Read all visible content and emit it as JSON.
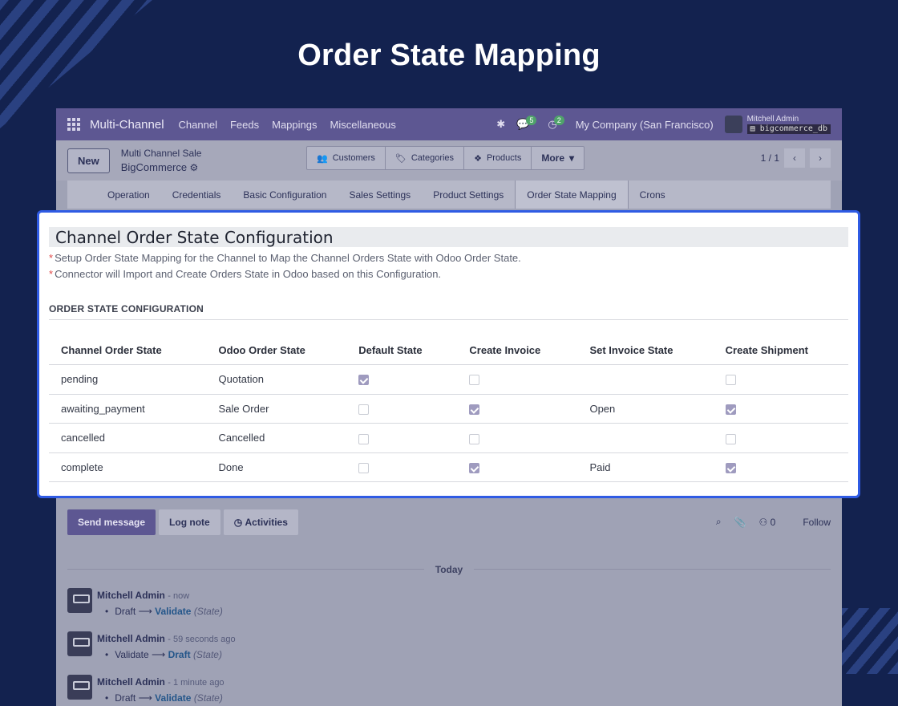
{
  "page_title": "Order State Mapping",
  "navbar": {
    "app_name": "Multi-Channel",
    "menus": [
      "Channel",
      "Feeds",
      "Mappings",
      "Miscellaneous"
    ],
    "messages_badge": "5",
    "activities_badge": "2",
    "company": "My Company (San Francisco)",
    "user_name": "Mitchell Admin",
    "database": "bigcommerce_db"
  },
  "control_panel": {
    "new_label": "New",
    "breadcrumb_parent": "Multi Channel Sale",
    "breadcrumb_record": "BigCommerce",
    "smart_buttons": [
      "Customers",
      "Categories",
      "Products",
      "More"
    ],
    "pager": "1 / 1"
  },
  "tabs": [
    "Operation",
    "Credentials",
    "Basic Configuration",
    "Sales Settings",
    "Product Settings",
    "Order State Mapping",
    "Crons"
  ],
  "card": {
    "title": "Channel Order State Configuration",
    "notes": [
      "Setup Order State Mapping for the Channel to Map the Channel Orders State with Odoo Order State.",
      "Connector will Import and Create Orders State in Odoo based on this Configuration."
    ],
    "section_label": "ORDER STATE CONFIGURATION",
    "columns": [
      "Channel Order State",
      "Odoo Order State",
      "Default State",
      "Create Invoice",
      "Set Invoice State",
      "Create Shipment"
    ],
    "rows": [
      {
        "channel_state": "pending",
        "odoo_state": "Quotation",
        "default_state": true,
        "create_invoice": false,
        "invoice_state": "",
        "create_shipment": false
      },
      {
        "channel_state": "awaiting_payment",
        "odoo_state": "Sale Order",
        "default_state": false,
        "create_invoice": true,
        "invoice_state": "Open",
        "create_shipment": true
      },
      {
        "channel_state": "cancelled",
        "odoo_state": "Cancelled",
        "default_state": false,
        "create_invoice": false,
        "invoice_state": "",
        "create_shipment": false
      },
      {
        "channel_state": "complete",
        "odoo_state": "Done",
        "default_state": false,
        "create_invoice": true,
        "invoice_state": "Paid",
        "create_shipment": true
      }
    ]
  },
  "chatter": {
    "send_message": "Send message",
    "log_note": "Log note",
    "activities": "Activities",
    "followers_count": "0",
    "follow": "Follow",
    "today": "Today",
    "messages": [
      {
        "author": "Mitchell Admin",
        "time": "- now",
        "from": "Draft",
        "to": "Validate",
        "field": "(State)"
      },
      {
        "author": "Mitchell Admin",
        "time": "- 59 seconds ago",
        "from": "Validate",
        "to": "Draft",
        "field": "(State)"
      },
      {
        "author": "Mitchell Admin",
        "time": "- 1 minute ago",
        "from": "Draft",
        "to": "Validate",
        "field": "(State)"
      }
    ]
  },
  "colors": {
    "background": "#13224f",
    "card_border": "#2f5be4",
    "navbar": "#5d5792",
    "checkbox_checked": "#9f9bbf",
    "required_star": "#e04848"
  }
}
